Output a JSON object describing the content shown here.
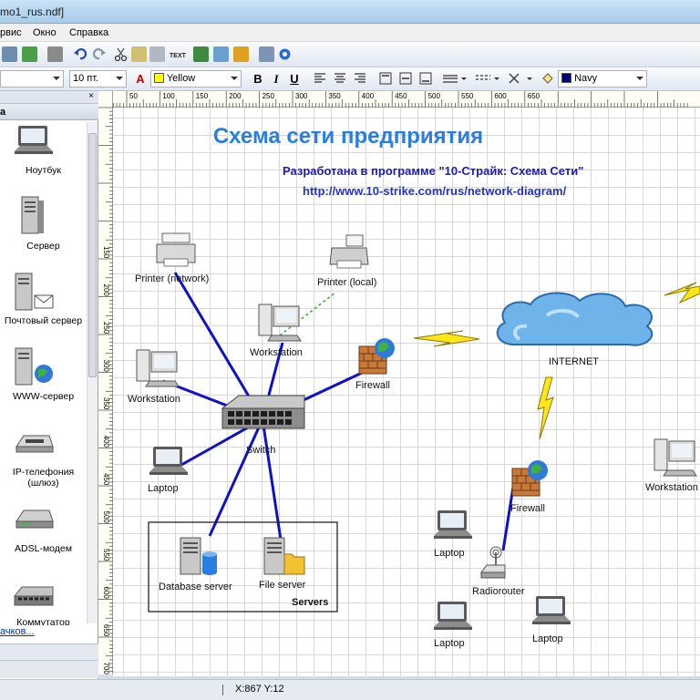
{
  "window": {
    "title": "mo1_rus.ndf]"
  },
  "menu": {
    "items": [
      {
        "label": "рвис"
      },
      {
        "label": "Окно"
      },
      {
        "label": "Справка"
      }
    ]
  },
  "format_toolbar": {
    "font_size": "10 пт.",
    "fill_color_name": "Yellow",
    "fill_color": "#ffff00",
    "line_color_name": "Navy",
    "line_color": "#000080",
    "bold": "B",
    "italic": "I",
    "underline": "U"
  },
  "library": {
    "title": "а",
    "close": "×",
    "items": [
      {
        "label": "Ноутбук"
      },
      {
        "label": "Сервер"
      },
      {
        "label": "Почтовый сервер"
      },
      {
        "label": "WWW-сервер"
      },
      {
        "label": "IP-телефония (шлюз)"
      },
      {
        "label": "ADSL-модем"
      },
      {
        "label": "Коммутатор"
      }
    ],
    "link": "ачков..."
  },
  "ruler": {
    "h_ticks": [
      "50",
      "100",
      "150",
      "200",
      "250",
      "300",
      "350",
      "400",
      "450",
      "500",
      "550",
      "600",
      "650"
    ],
    "v_ticks": [
      "150",
      "200",
      "250",
      "300",
      "350",
      "400",
      "450",
      "500",
      "550",
      "600",
      "650",
      "700"
    ]
  },
  "diagram": {
    "title": "Схема сети предприятия",
    "subtitle": "Разработана в программе \"10-Страйк: Схема Сети\"",
    "url": "http://www.10-strike.com/rus/network-diagram/",
    "title_color": "#2a7de1",
    "subtitle_color": "#1b1bb5",
    "link_color": "#2233c8",
    "nodes": {
      "printer_network": "Printer (network)",
      "printer_local": "Printer (local)",
      "workstation_top": "Workstation",
      "workstation_left": "Workstation",
      "firewall_main": "Firewall",
      "internet": "INTERNET",
      "switch": "Switch",
      "laptop_left": "Laptop",
      "database_server": "Database server",
      "file_server": "File server",
      "servers_group": "Servers",
      "firewall_remote": "Firewall",
      "laptop_r1": "Laptop",
      "radiorouter": "Radiorouter",
      "laptop_r2": "Laptop",
      "laptop_r3": "Laptop",
      "workstation_right": "Workstation"
    },
    "link_color_wired": "#1010c8",
    "link_color_local": "#33aa33"
  },
  "status": {
    "cursor": "X:867  Y:12"
  }
}
